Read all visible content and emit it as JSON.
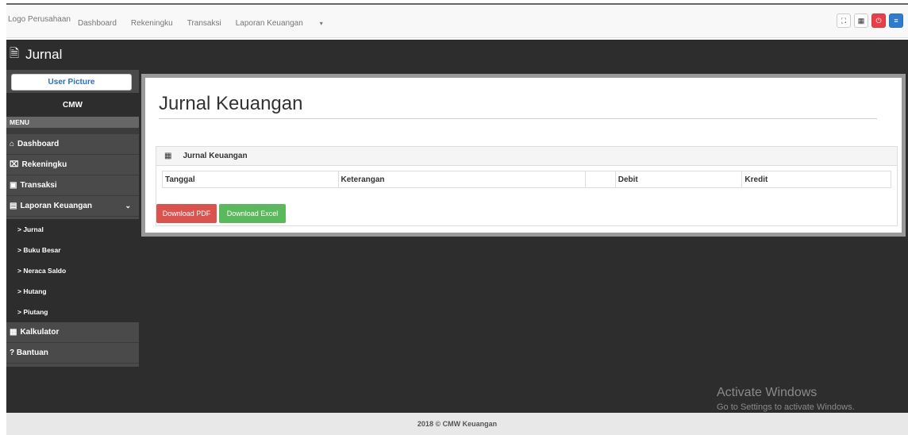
{
  "navbar": {
    "brand": "Logo Perusahaan",
    "links": [
      "Dashboard",
      "Rekeningku",
      "Transaksi",
      "Laporan Keuangan"
    ],
    "buttons": [
      {
        "icon": "expand-icon",
        "glyph": "⛶"
      },
      {
        "icon": "calculator-icon",
        "glyph": "▦"
      },
      {
        "icon": "power-icon",
        "glyph": "⏻"
      },
      {
        "icon": "menu-icon",
        "glyph": "≡"
      }
    ]
  },
  "titlebar": {
    "title": "Jurnal",
    "icon": "document-icon"
  },
  "sidebar": {
    "user_picture": "User Picture",
    "user_name": "CMW",
    "menu_header": "MENU",
    "items": [
      {
        "label": "Dashboard",
        "icon": "home-icon",
        "glyph": "⌂"
      },
      {
        "label": "Rekeningku",
        "icon": "bank-icon",
        "glyph": "⌧"
      },
      {
        "label": "Transaksi",
        "icon": "money-icon",
        "glyph": "▣"
      },
      {
        "label": "Laporan Keuangan",
        "icon": "file-icon",
        "glyph": "▤"
      }
    ],
    "subitems": [
      "> Jurnal",
      "> Buku Besar",
      "> Neraca Saldo",
      "> Hutang",
      "> Piutang"
    ],
    "bottom_items": [
      {
        "label": "Kalkulator",
        "icon": "calculator-icon",
        "glyph": "▦"
      },
      {
        "label": "? Bantuan",
        "icon": "",
        "glyph": ""
      }
    ]
  },
  "main": {
    "page_title": "Jurnal Keuangan",
    "box_title": "Jurnal Keuangan",
    "table_headers": [
      "Tanggal",
      "Keterangan",
      "",
      "Debit",
      "Kredit"
    ],
    "buttons": {
      "pdf": "Download PDF",
      "excel": "Download Excel"
    }
  },
  "watermark": {
    "line1": "Activate Windows",
    "line2": "Go to Settings to activate Windows."
  },
  "footer": "2018 © CMW Keuangan",
  "colors": {
    "danger": "#d9534f",
    "success": "#5cb85c",
    "sidebar": "#4a4a4a",
    "dark": "#2d2d2d"
  }
}
